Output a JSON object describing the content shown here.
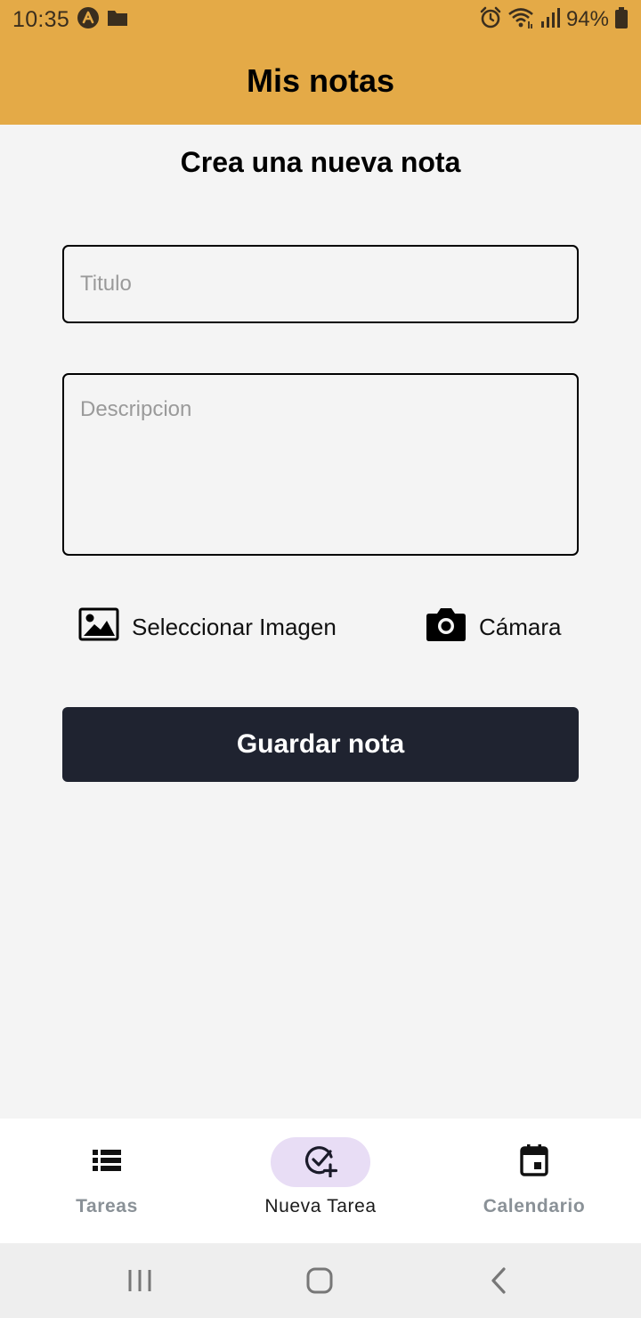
{
  "status_bar": {
    "time": "10:35",
    "battery": "94%",
    "icons": [
      "app-notification-icon",
      "folder-icon",
      "alarm-icon",
      "wifi-icon",
      "signal-icon",
      "battery-icon"
    ]
  },
  "app_bar": {
    "title": "Mis notas"
  },
  "form": {
    "heading": "Crea una nueva nota",
    "title_input": {
      "value": "",
      "placeholder": "Titulo"
    },
    "description_input": {
      "value": "",
      "placeholder": "Descripcion"
    },
    "select_image_label": "Seleccionar Imagen",
    "camera_label": "Cámara",
    "save_label": "Guardar nota"
  },
  "bottom_nav": {
    "items": [
      {
        "label": "Tareas",
        "icon": "list-icon",
        "active": false
      },
      {
        "label": "Nueva Tarea",
        "icon": "check-add-icon",
        "active": true
      },
      {
        "label": "Calendario",
        "icon": "calendar-icon",
        "active": false
      }
    ]
  },
  "colors": {
    "header": "#e4aa47",
    "background": "#f4f4f4",
    "save_button": "#1f2330",
    "active_pill": "#e8ddf5",
    "inactive_nav_text": "#8a9197"
  }
}
